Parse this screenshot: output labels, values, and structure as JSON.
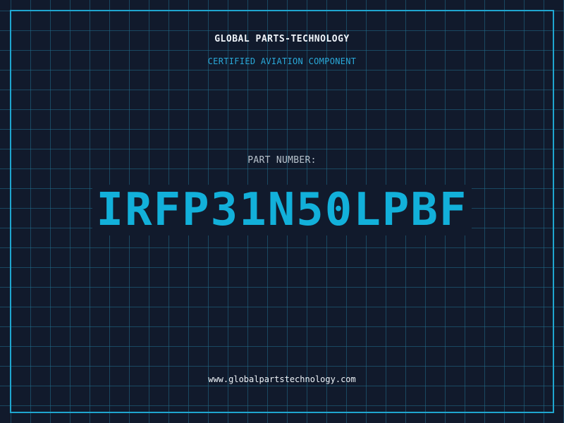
{
  "header": {
    "company": "GLOBAL PARTS-TECHNOLOGY",
    "tagline": "CERTIFIED AVIATION COMPONENT"
  },
  "main": {
    "part_label": "PART NUMBER:",
    "part_number": "IRFP31N50LPBF"
  },
  "footer": {
    "website": "www.globalpartstechnology.com"
  },
  "colors": {
    "background": "#111a2c",
    "grid": "#206e8c",
    "accent": "#12b0da",
    "frame": "#1fa6cf",
    "text": "#eef3f8",
    "muted_text": "#b8c2cc"
  }
}
